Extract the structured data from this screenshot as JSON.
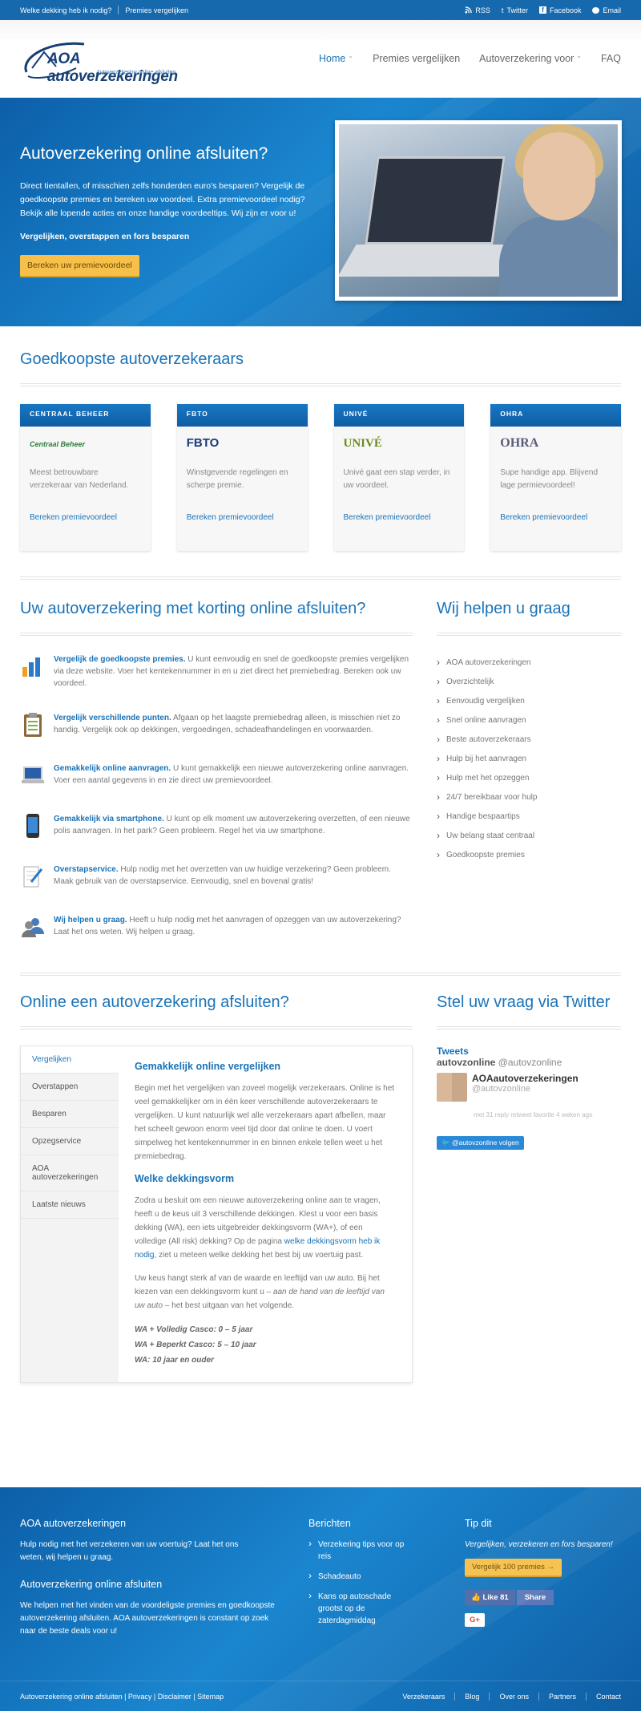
{
  "topbar": {
    "links": [
      "Welke dekking heb ik nodig?",
      "Premies vergelijken"
    ],
    "social": [
      "RSS",
      "Twitter",
      "Facebook",
      "Email"
    ]
  },
  "logo": {
    "title": "AOA autoverzekeringen",
    "subtitle": "Autoverzekering online afsluiten"
  },
  "nav": [
    "Home",
    "Premies vergelijken",
    "Autoverzekering voor",
    "FAQ"
  ],
  "hero": {
    "title": "Autoverzekering online afsluiten?",
    "text": "Direct tientallen, of misschien zelfs honderden euro's besparen? Vergelijk de goedkoopste premies en bereken uw voordeel. Extra premievoordeel nodig? Bekijk alle lopende acties en onze handige voordeeltips. Wij zijn er voor u!",
    "strong": "Vergelijken, overstappen en fors besparen",
    "button": "Bereken uw premievoordeel"
  },
  "insurers": {
    "title": "Goedkoopste autoverzekeraars",
    "cards": [
      {
        "name": "CENTRAAL BEHEER",
        "logo": "Centraal Beheer",
        "desc": "Meest betrouwbare verzekeraar van Nederland.",
        "link": "Bereken premievoordeel"
      },
      {
        "name": "FBTO",
        "logo": "FBTO",
        "desc": "Winstgevende regelingen en scherpe premie.",
        "link": "Bereken premievoordeel"
      },
      {
        "name": "UNIVÉ",
        "logo": "UNIVÉ",
        "desc": "Univé gaat een stap verder, in uw voordeel.",
        "link": "Bereken premievoordeel"
      },
      {
        "name": "OHRA",
        "logo": "OHRA",
        "desc": "Supe handige app. Blijvend lage permievoordeel!",
        "link": "Bereken premievoordeel"
      }
    ]
  },
  "features": {
    "title": "Uw autoverzekering met korting online afsluiten?",
    "items": [
      {
        "bold": "Vergelijk de goedkoopste premies.",
        "text": " U kunt eenvoudig en snel de goedkoopste premies vergelijken via deze website. Voer het kentekennummer in en u ziet direct het premiebedrag. Bereken ook uw voordeel."
      },
      {
        "bold": "Vergelijk verschillende punten.",
        "text": " Afgaan op het laagste premiebedrag alleen, is misschien niet zo handig. Vergelijk ook op dekkingen, vergoedingen, schadeafhandelingen en voorwaarden."
      },
      {
        "bold": "Gemakkelijk online aanvragen.",
        "text": " U kunt gemakkelijk een nieuwe autoverzekering online aanvragen. Voer een aantal gegevens in en zie direct uw premievoordeel."
      },
      {
        "bold": "Gemakkelijk via smartphone.",
        "text": " U kunt op elk moment uw autoverzekering overzetten, of een nieuwe polis aanvragen. In het park? Geen probleem. Regel het via uw smartphone."
      },
      {
        "bold": "Overstapservice.",
        "text": " Hulp nodig met het overzetten van uw huidige verzekering? Geen probleem. Maak gebruik van de overstapservice. Eenvoudig, snel en bovenal gratis!"
      },
      {
        "bold": "Wij helpen u graag.",
        "text": " Heeft u hulp nodig met het aanvragen of opzeggen van uw autoverzekering? Laat het ons weten. Wij helpen u graag."
      }
    ]
  },
  "help": {
    "title": "Wij helpen u graag",
    "items": [
      "AOA autoverzekeringen",
      "Overzichtelijk",
      "Eenvoudig vergelijken",
      "Snel online aanvragen",
      "Beste autoverzekeraars",
      "Hulp bij het aanvragen",
      "Hulp met het opzeggen",
      "24/7 bereikbaar voor hulp",
      "Handige bespaartips",
      "Uw belang staat centraal",
      "Goedkoopste premies"
    ]
  },
  "online": {
    "title": "Online een autoverzekering afsluiten?",
    "tabs": [
      "Vergelijken",
      "Overstappen",
      "Besparen",
      "Opzegservice",
      "AOA autoverzekeringen",
      "Laatste nieuws"
    ],
    "h1": "Gemakkelijk online vergelijken",
    "p1": "Begin met het vergelijken van zoveel mogelijk verzekeraars. Online is het veel gemakkelijker om in één keer verschillende autoverzekeraars te vergelijken. U kunt natuurlijk wel alle verzekeraars apart afbellen, maar het scheelt gewoon enorm veel tijd door dat online te doen. U voert simpelweg het kentekennummer in en binnen enkele tellen weet u het premiebedrag.",
    "h2": "Welke dekkingsvorm",
    "p2a": "Zodra u besluit om een nieuwe autoverzekering online aan te vragen, heeft u de keus uit 3 verschillende dekkingen. Klest u voor een basis dekking (WA), een iets uitgebreider dekkingsvorm (WA+), of een volledige (All risk) dekking? Op de pagina ",
    "p2link": "welke dekkingsvorm heb ik nodig",
    "p2b": ", ziet u meteen welke dekking het best bij uw voertuig past.",
    "p3a": "Uw keus hangt sterk af van de waarde en leeftijd van uw auto. Bij het kiezen van een dekkingsvorm kunt u – ",
    "p3i": "aan de hand van de leeftijd van uw auto",
    "p3b": " – het best uitgaan van het volgende.",
    "list": [
      "WA + Volledig Casco: 0 – 5 jaar",
      "WA + Beperkt Casco: 5 – 10 jaar",
      "WA: 10 jaar en ouder"
    ]
  },
  "twitter": {
    "title": "Stel uw vraag via Twitter",
    "tweets": "Tweets",
    "account": "autovzonline",
    "handle": "@autovzonline",
    "name": "AOAautoverzekeringen",
    "meta": "met 31 reply retweet favorite 4 weken ago",
    "follow": "@autovzonline volgen"
  },
  "footer": {
    "c1_title": "AOA autoverzekeringen",
    "c1_text": "Hulp nodig met het verzekeren van uw voertuig? Laat het ons weten, wij helpen u graag.",
    "c1_title2": "Autoverzekering online afsluiten",
    "c1_text2": "We helpen met het vinden van de voordeligste premies en goedkoopste autoverzekering afsluiten. AOA autoverzekeringen is constant op zoek naar de beste deals voor u!",
    "c2_title": "Berichten",
    "c2_items": [
      "Verzekering tips voor op reis",
      "Schadeauto",
      "Kans op autoschade grootst op de zaterdagmiddag"
    ],
    "c3_title": "Tip dit",
    "c3_text": "Vergelijken, verzekeren en fors besparen!",
    "c3_button": "Vergelijk 100 premies →",
    "like": "Like 81",
    "share": "Share",
    "gplus": "G+",
    "bottom_left": "Autoverzekering online afsluiten | Privacy | Disclaimer | Sitemap",
    "bottom_right": [
      "Verzekeraars",
      "Blog",
      "Over ons",
      "Partners",
      "Contact"
    ]
  }
}
